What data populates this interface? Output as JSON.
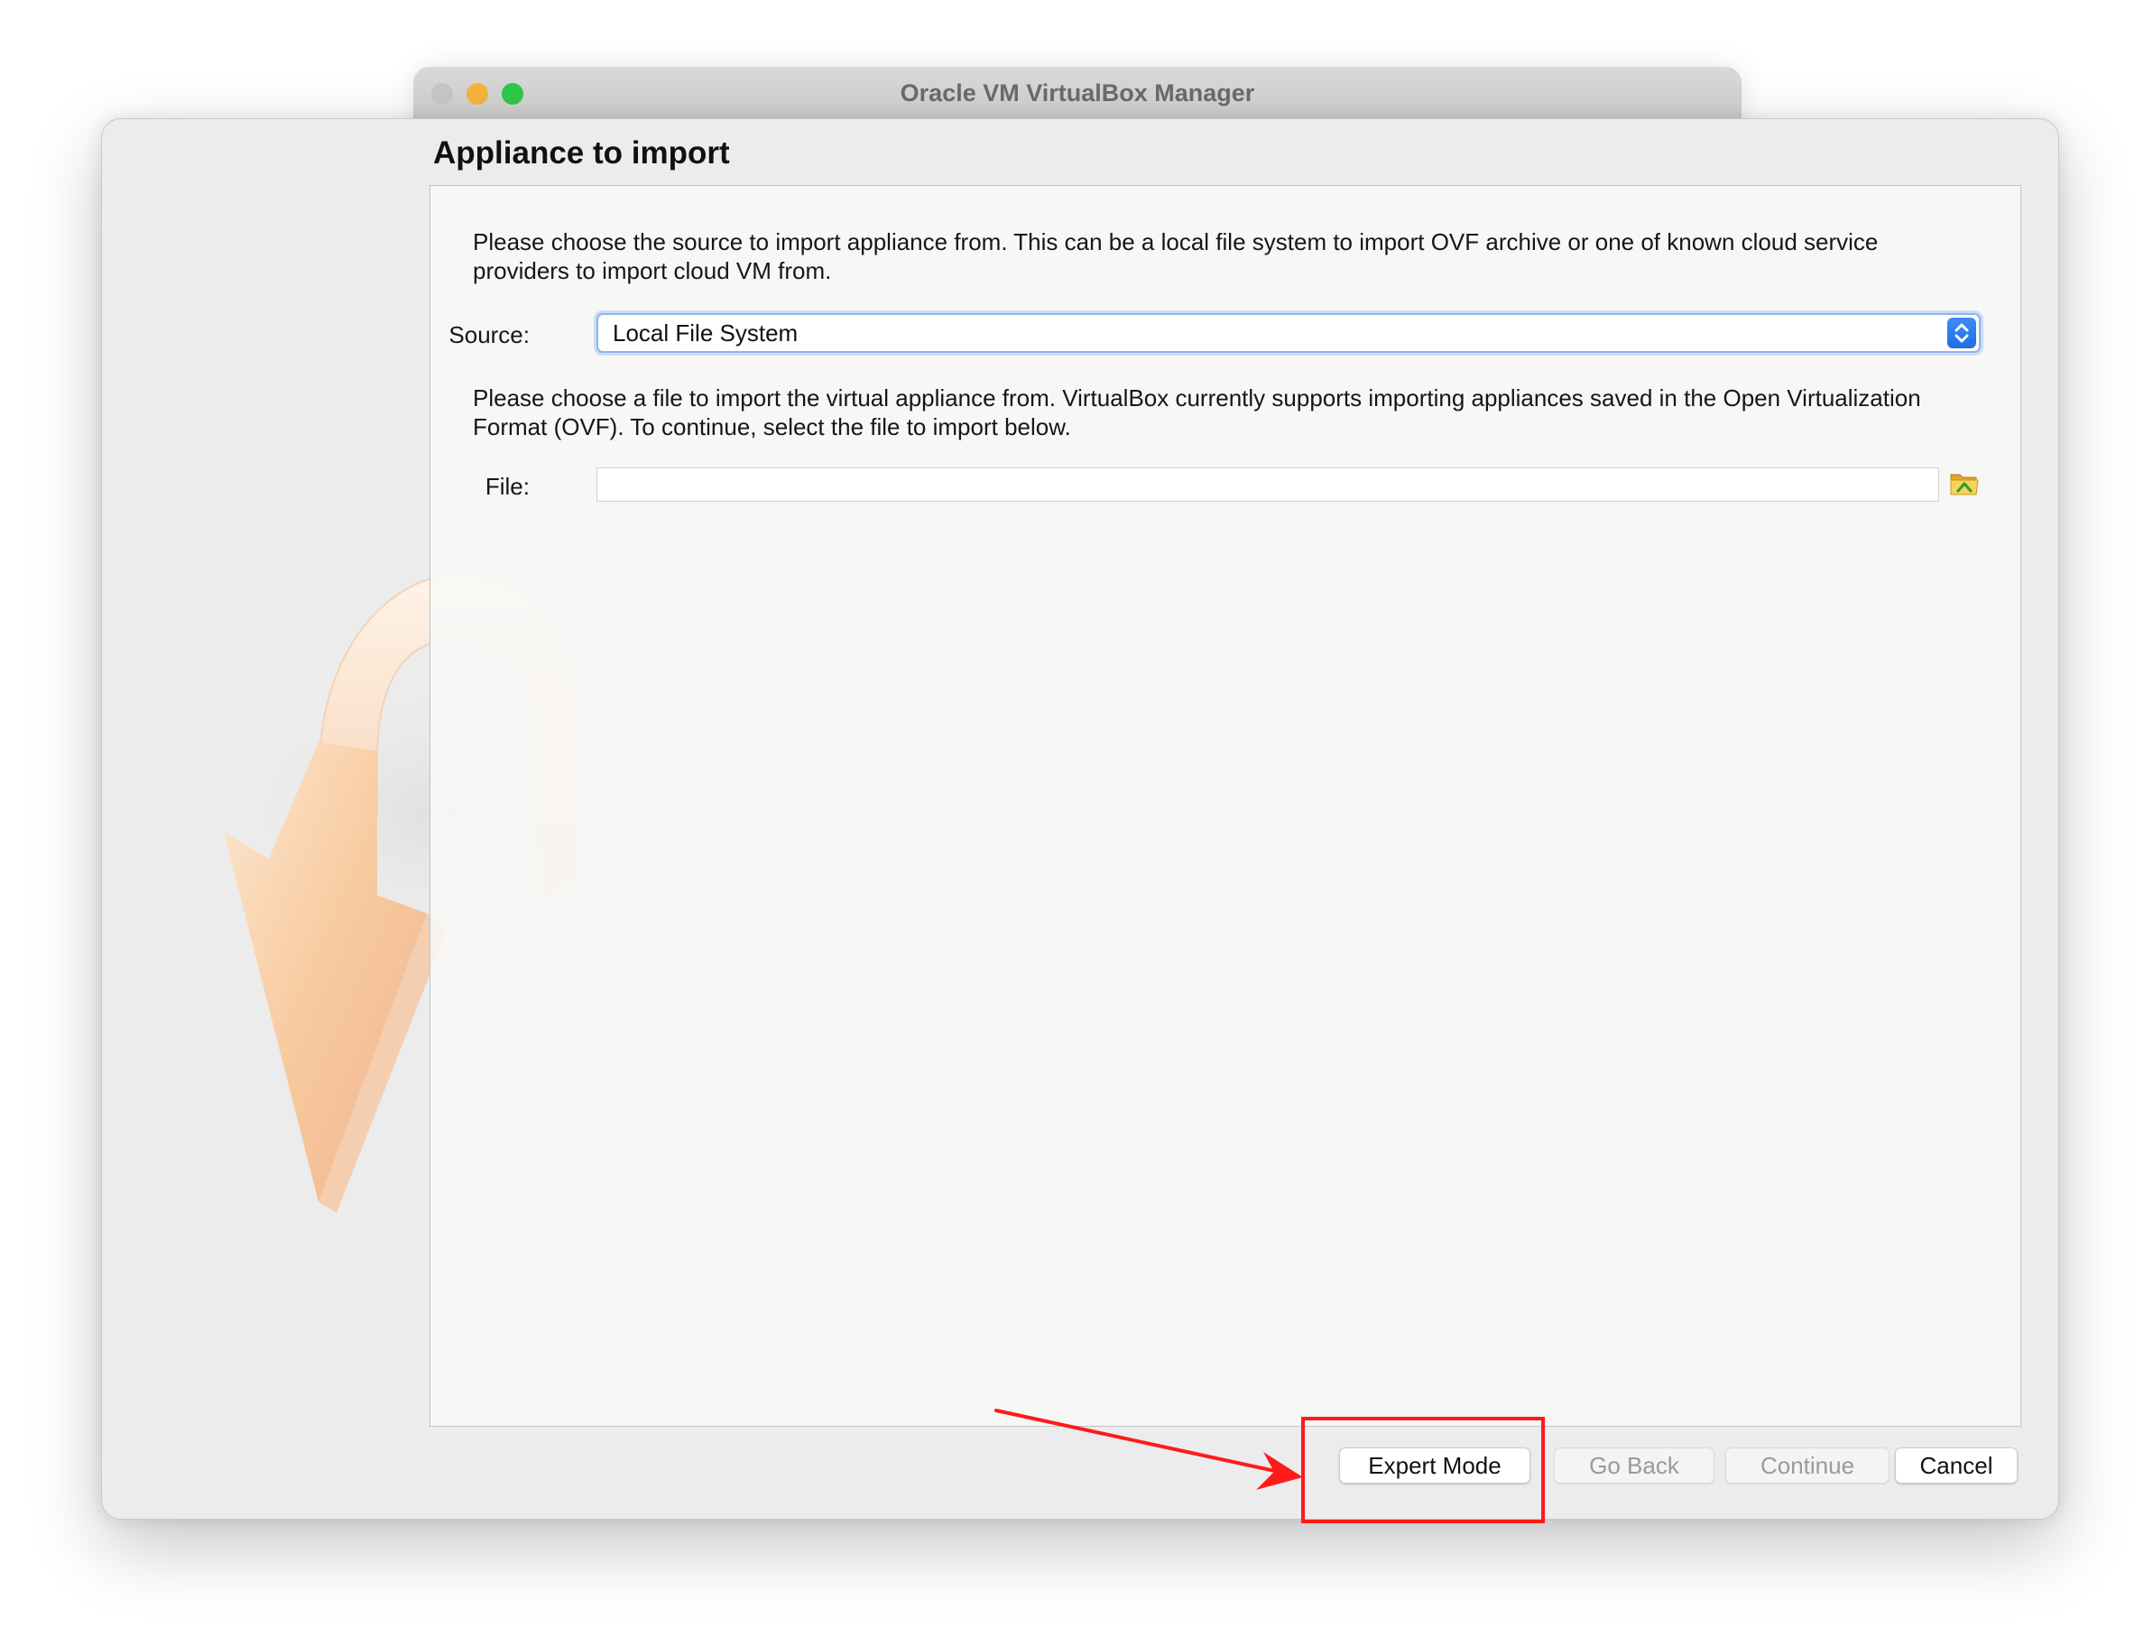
{
  "main_window": {
    "title": "Oracle VM VirtualBox Manager"
  },
  "dialog": {
    "heading": "Appliance to import",
    "description_source": "Please choose the source to import appliance from. This can be a local file system to import OVF archive or one of known cloud service providers to import cloud VM from.",
    "source": {
      "label": "Source:",
      "selected": "Local File System"
    },
    "description_file": "Please choose a file to import the virtual appliance from. VirtualBox currently supports importing appliances saved in the Open Virtualization Format (OVF). To continue, select the file to import below.",
    "file": {
      "label": "File:",
      "value": "",
      "browse_icon": "folder-open-icon"
    }
  },
  "buttons": {
    "expert_mode": "Expert Mode",
    "go_back": "Go Back",
    "continue": "Continue",
    "cancel": "Cancel"
  },
  "annotation": {
    "color": "#ff1a1a",
    "target": "Expert Mode"
  },
  "colors": {
    "dialog_bg": "#ececec",
    "panel_bg": "#f8f8f7",
    "select_accent": "#1d6fe6",
    "traffic_yellow": "#f6b43a",
    "traffic_green": "#2ec84a"
  }
}
